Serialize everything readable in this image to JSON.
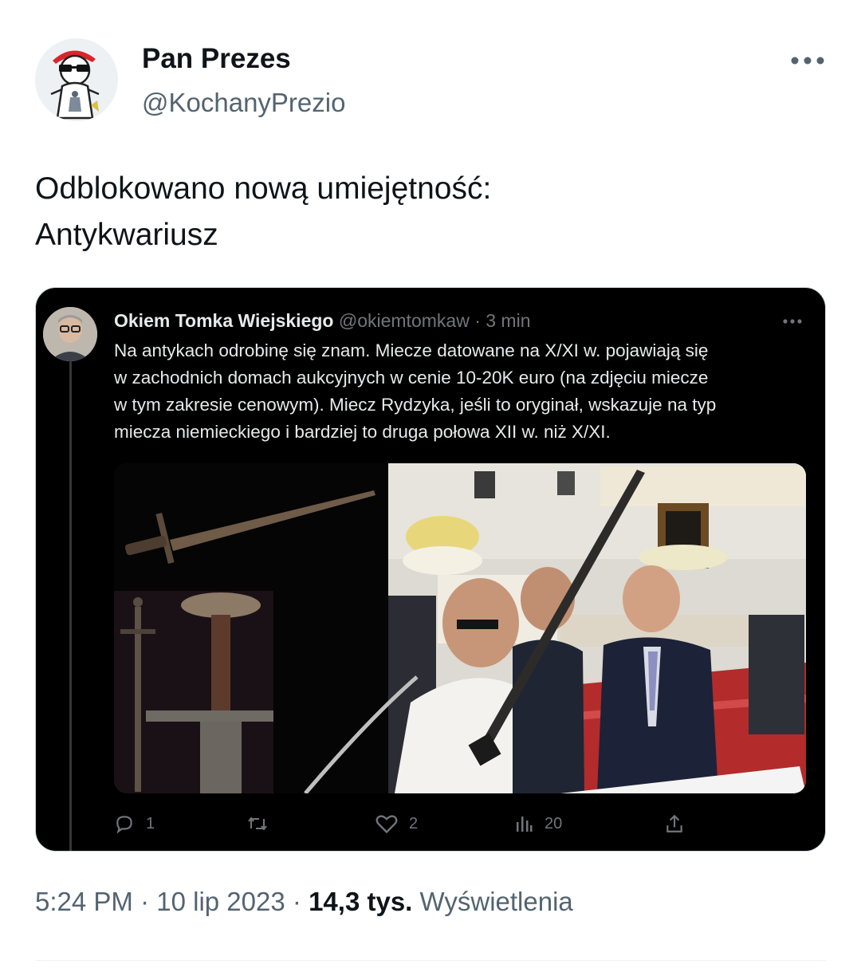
{
  "tweet": {
    "display_name": "Pan Prezes",
    "handle": "@KochanyPrezio",
    "text_lines": [
      "Odblokowano nową umiejętność:",
      "Antykwariusz"
    ],
    "time": "5:24 PM",
    "date": "10 lip 2023",
    "separator": "·",
    "views_count": "14,3 tys.",
    "views_label": "Wyświetlenia"
  },
  "quoted": {
    "name": "Okiem Tomka Wiejskiego",
    "handle": "@okiemtomkaw",
    "time": "· 3 min",
    "text_lines": [
      "Na antykach odrobinę się znam. Miecze datowane na X/XI w. pojawiają się",
      "w zachodnich domach aukcyjnych w cenie 10-20K euro (na zdjęciu miecze",
      "w tym zakresie cenowym). Miecz Rydzyka, jeśli to oryginał, wskazuje na typ",
      "miecza niemieckiego i bardziej to druga połowa XII w. niż X/XI."
    ],
    "actions": {
      "replies": "1",
      "likes": "2",
      "views": "20"
    }
  },
  "colors": {
    "text_primary": "#0f1419",
    "text_secondary": "#536471",
    "dark_bg": "#000000",
    "dark_text": "#e7e9ea",
    "dark_muted": "#71767b"
  }
}
